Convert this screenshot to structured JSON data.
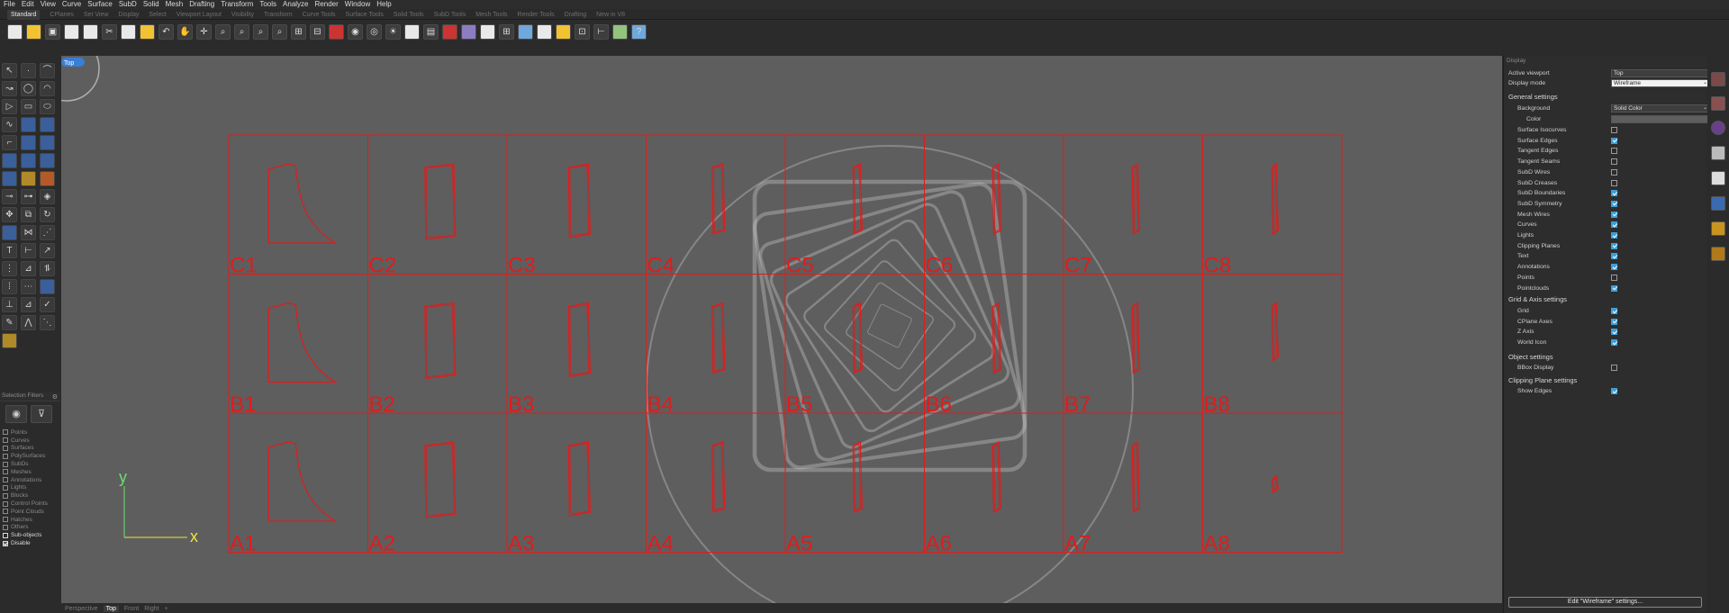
{
  "menubar": [
    "File",
    "Edit",
    "View",
    "Curve",
    "Surface",
    "SubD",
    "Solid",
    "Mesh",
    "Drafting",
    "Transform",
    "Tools",
    "Analyze",
    "Render",
    "Window",
    "Help"
  ],
  "tabs": [
    "Standard",
    "CPlanes",
    "Set View",
    "Display",
    "Select",
    "Viewport Layout",
    "Visibility",
    "Transform",
    "Curve Tools",
    "Surface Tools",
    "Solid Tools",
    "SubD Tools",
    "Mesh Tools",
    "Render Tools",
    "Drafting",
    "New in V8"
  ],
  "active_tab": "Standard",
  "viewport": {
    "label": "Top",
    "cells": [
      {
        "label": "C1",
        "row": 0,
        "col": 0
      },
      {
        "label": "C2",
        "row": 0,
        "col": 1
      },
      {
        "label": "C3",
        "row": 0,
        "col": 2
      },
      {
        "label": "C4",
        "row": 0,
        "col": 3
      },
      {
        "label": "C5",
        "row": 0,
        "col": 4
      },
      {
        "label": "C6",
        "row": 0,
        "col": 5
      },
      {
        "label": "C7",
        "row": 0,
        "col": 6
      },
      {
        "label": "C8",
        "row": 0,
        "col": 7
      },
      {
        "label": "B1",
        "row": 1,
        "col": 0
      },
      {
        "label": "B2",
        "row": 1,
        "col": 1
      },
      {
        "label": "B3",
        "row": 1,
        "col": 2
      },
      {
        "label": "B4",
        "row": 1,
        "col": 3
      },
      {
        "label": "B5",
        "row": 1,
        "col": 4
      },
      {
        "label": "B6",
        "row": 1,
        "col": 5
      },
      {
        "label": "B7",
        "row": 1,
        "col": 6
      },
      {
        "label": "B8",
        "row": 1,
        "col": 7
      },
      {
        "label": "A1",
        "row": 2,
        "col": 0
      },
      {
        "label": "A2",
        "row": 2,
        "col": 1
      },
      {
        "label": "A3",
        "row": 2,
        "col": 2
      },
      {
        "label": "A4",
        "row": 2,
        "col": 3
      },
      {
        "label": "A5",
        "row": 2,
        "col": 4
      },
      {
        "label": "A6",
        "row": 2,
        "col": 5
      },
      {
        "label": "A7",
        "row": 2,
        "col": 6
      },
      {
        "label": "A8",
        "row": 2,
        "col": 7
      }
    ],
    "axis_x": "x",
    "axis_y": "y",
    "axis_x_color": "#e8e83a",
    "axis_y_color": "#6be06b",
    "geometry_color": "#e01c1c"
  },
  "viewport_tabs": [
    "Perspective",
    "Top",
    "Front",
    "Right",
    "+"
  ],
  "active_viewport_tab": "Top",
  "selection_filters": {
    "title": "Selection Filters",
    "items": [
      {
        "label": "Points",
        "checked": false
      },
      {
        "label": "Curves",
        "checked": false
      },
      {
        "label": "Surfaces",
        "checked": false
      },
      {
        "label": "PolySurfaces",
        "checked": false
      },
      {
        "label": "SubDs",
        "checked": false
      },
      {
        "label": "Meshes",
        "checked": false
      },
      {
        "label": "Annotations",
        "checked": false
      },
      {
        "label": "Lights",
        "checked": false
      },
      {
        "label": "Blocks",
        "checked": false
      },
      {
        "label": "Control Points",
        "checked": false
      },
      {
        "label": "Point Clouds",
        "checked": false
      },
      {
        "label": "Hatches",
        "checked": false
      },
      {
        "label": "Others",
        "checked": false
      },
      {
        "label": "Sub-objects",
        "checked": false,
        "bright": true
      },
      {
        "label": "Disable",
        "checked": true
      }
    ]
  },
  "display_panel": {
    "title": "Display",
    "active_viewport_label": "Active viewport",
    "active_viewport_value": "Top",
    "display_mode_label": "Display mode",
    "display_mode_value": "Wireframe",
    "general_title": "General settings",
    "background_label": "Background",
    "background_value": "Solid Color",
    "color_label": "Color",
    "general_items": [
      {
        "label": "Surface Isocurves",
        "checked": false
      },
      {
        "label": "Surface Edges",
        "checked": true
      },
      {
        "label": "Tangent Edges",
        "checked": false
      },
      {
        "label": "Tangent Seams",
        "checked": false
      },
      {
        "label": "SubD Wires",
        "checked": false
      },
      {
        "label": "SubD Creases",
        "checked": false
      },
      {
        "label": "SubD Boundaries",
        "checked": true
      },
      {
        "label": "SubD Symmetry",
        "checked": true
      },
      {
        "label": "Mesh Wires",
        "checked": true
      },
      {
        "label": "Curves",
        "checked": true
      },
      {
        "label": "Lights",
        "checked": true
      },
      {
        "label": "Clipping Planes",
        "checked": true
      },
      {
        "label": "Text",
        "checked": true
      },
      {
        "label": "Annotations",
        "checked": true
      },
      {
        "label": "Points",
        "checked": false
      },
      {
        "label": "Pointclouds",
        "checked": true
      }
    ],
    "grid_title": "Grid & Axis settings",
    "grid_items": [
      {
        "label": "Grid",
        "checked": true
      },
      {
        "label": "CPlane Axes",
        "checked": true
      },
      {
        "label": "Z Axis",
        "checked": true
      },
      {
        "label": "World Icon",
        "checked": true
      }
    ],
    "object_title": "Object settings",
    "object_items": [
      {
        "label": "BBox Display",
        "checked": false
      }
    ],
    "clipping_title": "Clipping Plane settings",
    "clipping_items": [
      {
        "label": "Show Edges",
        "checked": true
      }
    ],
    "edit_button": "Edit \"Wireframe\" settings..."
  },
  "accent_color": "#3e9fd9"
}
